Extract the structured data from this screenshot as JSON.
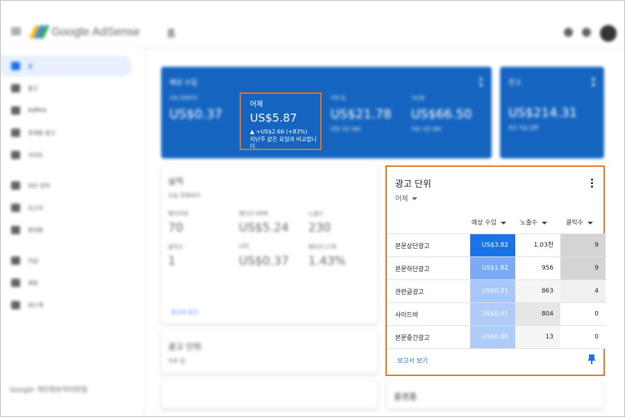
{
  "app": {
    "brand": "Google AdSense",
    "page_title": "홈"
  },
  "sidebar": {
    "items": [
      {
        "label": "홈",
        "active": true
      },
      {
        "label": "광고"
      },
      {
        "label": "AdMob"
      },
      {
        "label": "검색용 광고"
      },
      {
        "label": "사이트"
      },
      {
        "label": "차단 관리"
      },
      {
        "label": "보고서"
      },
      {
        "label": "최적화"
      },
      {
        "label": "지급"
      },
      {
        "label": "계정"
      },
      {
        "label": "피드백"
      }
    ],
    "footer": "Google 개인정보처리방침"
  },
  "estimated_earnings": {
    "title": "예상 수입",
    "metrics": [
      {
        "label": "오늘 현재까지",
        "value": "US$0.37"
      },
      {
        "label": "이번 달",
        "value": "US$21.78",
        "sub": "이전 기간 대비"
      },
      {
        "label": "지난달",
        "value": "US$66.50",
        "sub": "이전 기간 대비"
      }
    ],
    "yesterday": {
      "label": "어제",
      "value": "US$5.87",
      "change": "▲ +US$2.66 (+83%)",
      "compare": "지난주 같은 요일과 비교합니다."
    }
  },
  "balance": {
    "title": "잔고",
    "value": "US$214.31",
    "sub": "최근 지급 금액"
  },
  "performance": {
    "title": "실적",
    "period": "오늘 현재까지",
    "metrics": [
      {
        "label": "페이지뷰",
        "value": "70"
      },
      {
        "label": "페이지 RPM",
        "value": "US$5.24"
      },
      {
        "label": "노출수",
        "value": "230"
      },
      {
        "label": "클릭수",
        "value": "1"
      },
      {
        "label": "CPC",
        "value": "US$0.37"
      },
      {
        "label": "페이지 CTR",
        "value": "1.43%"
      }
    ],
    "link": "보고서 보기"
  },
  "ad_units_small": {
    "title": "광고 단위",
    "period": "이번 달"
  },
  "ad_units": {
    "title": "광고 단위",
    "period": "어제",
    "columns": [
      "예상 수입",
      "노출수",
      "클릭수"
    ],
    "rows": [
      {
        "name": "본문상단광고",
        "revenue": "US$3.82",
        "impressions": "1.03천",
        "clicks": "9",
        "rev_color": "#1a73e8",
        "imp_color": "#ffffff",
        "clk_color": "#d4d4d4"
      },
      {
        "name": "본문하단광고",
        "revenue": "US$1.82",
        "impressions": "956",
        "clicks": "9",
        "rev_color": "#7baaf7",
        "imp_color": "#ffffff",
        "clk_color": "#d4d4d4"
      },
      {
        "name": "관련글광고",
        "revenue": "US$0.21",
        "impressions": "863",
        "clicks": "4",
        "rev_color": "#a8c7fa",
        "imp_color": "#f5f5f5",
        "clk_color": "#f0f0f0"
      },
      {
        "name": "사이드바",
        "revenue": "US$0.01",
        "impressions": "804",
        "clicks": "0",
        "rev_color": "#aecbfa",
        "imp_color": "#e6e6e6",
        "clk_color": "#ffffff"
      },
      {
        "name": "본문중간광고",
        "revenue": "US$0.00",
        "impressions": "13",
        "clicks": "0",
        "rev_color": "#aecbfa",
        "imp_color": "#f5f5f5",
        "clk_color": "#ffffff"
      }
    ],
    "link": "보고서 보기"
  },
  "bottom_card": {
    "title": "플랫폼"
  },
  "colors": {
    "primary_blue": "#1565c0",
    "highlight": "#e8731a",
    "link": "#1a73e8"
  }
}
